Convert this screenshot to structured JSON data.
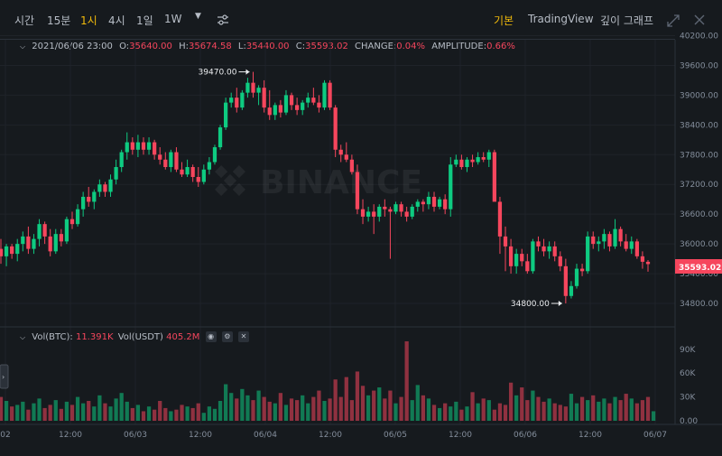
{
  "toolbar": {
    "items": [
      "시간",
      "15분",
      "1시",
      "4시",
      "1일",
      "1W"
    ],
    "active": "1시",
    "views": [
      "기본",
      "TradingView",
      "깊이 그래프"
    ],
    "active_view": "기본"
  },
  "ohlc": {
    "date": "2021/06/06 23:00",
    "o_label": "O:",
    "o": "35640.00",
    "h_label": "H:",
    "h": "35674.58",
    "l_label": "L:",
    "l": "35440.00",
    "c_label": "C:",
    "c": "35593.02",
    "change_label": "CHANGE:",
    "change": "0.04%",
    "amp_label": "AMPLITUDE:",
    "amp": "0.66%"
  },
  "volume_legend": {
    "btc_label": "Vol(BTC):",
    "btc": "11.391K",
    "usdt_label": "Vol(USDT)",
    "usdt": "405.2M"
  },
  "watermark": "BINANCE",
  "colors": {
    "up": "#0ecb81",
    "down": "#f6465d",
    "bg": "#161a1e",
    "accent": "#f0b90b"
  },
  "chart_data": {
    "type": "candlestick",
    "price_ticks": [
      "40200.00",
      "39600.00",
      "39000.00",
      "38400.00",
      "37800.00",
      "37200.00",
      "36600.00",
      "36000.00",
      "35400.00",
      "34800.00"
    ],
    "price_ylim": [
      34600,
      40300
    ],
    "volume_ticks": [
      "90K",
      "60K",
      "30K",
      "0.00"
    ],
    "volume_ylim": [
      0,
      100
    ],
    "time_ticks": [
      "02",
      "12:00",
      "06/03",
      "12:00",
      "06/04",
      "12:00",
      "06/05",
      "12:00",
      "06/06",
      "12:00",
      "06/07"
    ],
    "last_price": "35593.02",
    "annotations": [
      {
        "label": "39470.00",
        "value": 39470
      },
      {
        "label": "34800.00",
        "value": 34800
      }
    ],
    "candles": [
      {
        "o": 35900,
        "h": 36100,
        "l": 35600,
        "c": 35750
      },
      {
        "o": 35750,
        "h": 36000,
        "l": 35550,
        "c": 35950
      },
      {
        "o": 35950,
        "h": 36000,
        "l": 35700,
        "c": 35800
      },
      {
        "o": 35800,
        "h": 36100,
        "l": 35650,
        "c": 36000
      },
      {
        "o": 36000,
        "h": 36250,
        "l": 35850,
        "c": 36150
      },
      {
        "o": 36150,
        "h": 36350,
        "l": 35800,
        "c": 35900
      },
      {
        "o": 35900,
        "h": 36200,
        "l": 35800,
        "c": 36100
      },
      {
        "o": 36100,
        "h": 36500,
        "l": 35950,
        "c": 36400
      },
      {
        "o": 36400,
        "h": 36450,
        "l": 36000,
        "c": 36150
      },
      {
        "o": 36150,
        "h": 36300,
        "l": 35750,
        "c": 35850
      },
      {
        "o": 35850,
        "h": 36300,
        "l": 35800,
        "c": 36200
      },
      {
        "o": 36200,
        "h": 36300,
        "l": 35950,
        "c": 36050
      },
      {
        "o": 36050,
        "h": 36550,
        "l": 36000,
        "c": 36500
      },
      {
        "o": 36500,
        "h": 36650,
        "l": 36300,
        "c": 36400
      },
      {
        "o": 36400,
        "h": 36800,
        "l": 36350,
        "c": 36700
      },
      {
        "o": 36700,
        "h": 37050,
        "l": 36550,
        "c": 36950
      },
      {
        "o": 36950,
        "h": 37150,
        "l": 36750,
        "c": 36850
      },
      {
        "o": 36850,
        "h": 37100,
        "l": 36700,
        "c": 37050
      },
      {
        "o": 37050,
        "h": 37300,
        "l": 36950,
        "c": 37200
      },
      {
        "o": 37200,
        "h": 37250,
        "l": 36950,
        "c": 37050
      },
      {
        "o": 37050,
        "h": 37400,
        "l": 36950,
        "c": 37300
      },
      {
        "o": 37300,
        "h": 37700,
        "l": 37200,
        "c": 37550
      },
      {
        "o": 37550,
        "h": 37900,
        "l": 37450,
        "c": 37850
      },
      {
        "o": 37850,
        "h": 38250,
        "l": 37700,
        "c": 38050
      },
      {
        "o": 38050,
        "h": 38150,
        "l": 37800,
        "c": 37900
      },
      {
        "o": 37900,
        "h": 38200,
        "l": 37750,
        "c": 38050
      },
      {
        "o": 38050,
        "h": 38150,
        "l": 37800,
        "c": 37900
      },
      {
        "o": 37900,
        "h": 38150,
        "l": 37800,
        "c": 38050
      },
      {
        "o": 38050,
        "h": 38100,
        "l": 37700,
        "c": 37800
      },
      {
        "o": 37800,
        "h": 37950,
        "l": 37600,
        "c": 37700
      },
      {
        "o": 37700,
        "h": 37850,
        "l": 37500,
        "c": 37550
      },
      {
        "o": 37550,
        "h": 37900,
        "l": 37450,
        "c": 37850
      },
      {
        "o": 37850,
        "h": 37950,
        "l": 37450,
        "c": 37500
      },
      {
        "o": 37500,
        "h": 37650,
        "l": 37350,
        "c": 37400
      },
      {
        "o": 37400,
        "h": 37700,
        "l": 37350,
        "c": 37550
      },
      {
        "o": 37550,
        "h": 37600,
        "l": 37250,
        "c": 37350
      },
      {
        "o": 37350,
        "h": 37550,
        "l": 37150,
        "c": 37250
      },
      {
        "o": 37250,
        "h": 37600,
        "l": 37200,
        "c": 37500
      },
      {
        "o": 37500,
        "h": 37750,
        "l": 37400,
        "c": 37650
      },
      {
        "o": 37650,
        "h": 38000,
        "l": 37600,
        "c": 37950
      },
      {
        "o": 37950,
        "h": 38400,
        "l": 37900,
        "c": 38350
      },
      {
        "o": 38350,
        "h": 38950,
        "l": 38300,
        "c": 38850
      },
      {
        "o": 38850,
        "h": 39050,
        "l": 38750,
        "c": 38950
      },
      {
        "o": 38950,
        "h": 39150,
        "l": 38650,
        "c": 38750
      },
      {
        "o": 38750,
        "h": 39100,
        "l": 38700,
        "c": 39050
      },
      {
        "o": 39050,
        "h": 39350,
        "l": 38950,
        "c": 39250
      },
      {
        "o": 39250,
        "h": 39470,
        "l": 38950,
        "c": 39050
      },
      {
        "o": 39050,
        "h": 39200,
        "l": 38800,
        "c": 39150
      },
      {
        "o": 39150,
        "h": 39300,
        "l": 38650,
        "c": 38750
      },
      {
        "o": 38750,
        "h": 39100,
        "l": 38500,
        "c": 38600
      },
      {
        "o": 38600,
        "h": 38850,
        "l": 38500,
        "c": 38800
      },
      {
        "o": 38800,
        "h": 38900,
        "l": 38550,
        "c": 38650
      },
      {
        "o": 38650,
        "h": 39100,
        "l": 38600,
        "c": 39000
      },
      {
        "o": 39000,
        "h": 39050,
        "l": 38700,
        "c": 38800
      },
      {
        "o": 38800,
        "h": 38950,
        "l": 38600,
        "c": 38700
      },
      {
        "o": 38700,
        "h": 38900,
        "l": 38600,
        "c": 38850
      },
      {
        "o": 38850,
        "h": 39050,
        "l": 38750,
        "c": 38950
      },
      {
        "o": 38950,
        "h": 39150,
        "l": 38800,
        "c": 38850
      },
      {
        "o": 38850,
        "h": 39000,
        "l": 38650,
        "c": 38750
      },
      {
        "o": 38750,
        "h": 39300,
        "l": 38700,
        "c": 39250
      },
      {
        "o": 39250,
        "h": 39300,
        "l": 38700,
        "c": 38750
      },
      {
        "o": 38750,
        "h": 38800,
        "l": 37750,
        "c": 37900
      },
      {
        "o": 37900,
        "h": 38000,
        "l": 37650,
        "c": 37800
      },
      {
        "o": 37800,
        "h": 38050,
        "l": 37650,
        "c": 37700
      },
      {
        "o": 37700,
        "h": 37800,
        "l": 37400,
        "c": 37450
      },
      {
        "o": 37450,
        "h": 37600,
        "l": 36600,
        "c": 36700
      },
      {
        "o": 36700,
        "h": 36900,
        "l": 36400,
        "c": 36550
      },
      {
        "o": 36550,
        "h": 36750,
        "l": 36450,
        "c": 36650
      },
      {
        "o": 36650,
        "h": 36800,
        "l": 36200,
        "c": 36550
      },
      {
        "o": 36550,
        "h": 36800,
        "l": 36450,
        "c": 36750
      },
      {
        "o": 36750,
        "h": 36900,
        "l": 36550,
        "c": 36700
      },
      {
        "o": 36700,
        "h": 36750,
        "l": 35700,
        "c": 36650
      },
      {
        "o": 36650,
        "h": 36850,
        "l": 36600,
        "c": 36800
      },
      {
        "o": 36800,
        "h": 36850,
        "l": 36550,
        "c": 36650
      },
      {
        "o": 36650,
        "h": 36750,
        "l": 36450,
        "c": 36550
      },
      {
        "o": 36550,
        "h": 36800,
        "l": 36500,
        "c": 36750
      },
      {
        "o": 36750,
        "h": 36900,
        "l": 36650,
        "c": 36850
      },
      {
        "o": 36850,
        "h": 36900,
        "l": 36650,
        "c": 36800
      },
      {
        "o": 36800,
        "h": 37050,
        "l": 36700,
        "c": 36950
      },
      {
        "o": 36950,
        "h": 37050,
        "l": 36650,
        "c": 36750
      },
      {
        "o": 36750,
        "h": 36950,
        "l": 36700,
        "c": 36900
      },
      {
        "o": 36900,
        "h": 37000,
        "l": 36600,
        "c": 36700
      },
      {
        "o": 36700,
        "h": 37750,
        "l": 36550,
        "c": 37600
      },
      {
        "o": 37600,
        "h": 37800,
        "l": 37550,
        "c": 37700
      },
      {
        "o": 37700,
        "h": 37800,
        "l": 37500,
        "c": 37550
      },
      {
        "o": 37550,
        "h": 37750,
        "l": 37450,
        "c": 37700
      },
      {
        "o": 37700,
        "h": 37800,
        "l": 37550,
        "c": 37650
      },
      {
        "o": 37650,
        "h": 37850,
        "l": 37600,
        "c": 37750
      },
      {
        "o": 37750,
        "h": 37850,
        "l": 37650,
        "c": 37700
      },
      {
        "o": 37700,
        "h": 37900,
        "l": 37550,
        "c": 37850
      },
      {
        "o": 37850,
        "h": 37900,
        "l": 37050,
        "c": 36850
      },
      {
        "o": 36850,
        "h": 36950,
        "l": 35800,
        "c": 36150
      },
      {
        "o": 36150,
        "h": 36350,
        "l": 35450,
        "c": 35950
      },
      {
        "o": 35950,
        "h": 36100,
        "l": 35400,
        "c": 35550
      },
      {
        "o": 35550,
        "h": 35900,
        "l": 35400,
        "c": 35800
      },
      {
        "o": 35800,
        "h": 35900,
        "l": 35550,
        "c": 35650
      },
      {
        "o": 35650,
        "h": 35800,
        "l": 35400,
        "c": 35450
      },
      {
        "o": 35450,
        "h": 36100,
        "l": 35400,
        "c": 36050
      },
      {
        "o": 36050,
        "h": 36150,
        "l": 35850,
        "c": 35950
      },
      {
        "o": 35950,
        "h": 36100,
        "l": 35750,
        "c": 35850
      },
      {
        "o": 35850,
        "h": 36050,
        "l": 35700,
        "c": 35950
      },
      {
        "o": 35950,
        "h": 36050,
        "l": 35650,
        "c": 35750
      },
      {
        "o": 35750,
        "h": 35850,
        "l": 35450,
        "c": 35550
      },
      {
        "o": 35550,
        "h": 35700,
        "l": 34800,
        "c": 34950
      },
      {
        "o": 34950,
        "h": 35250,
        "l": 34900,
        "c": 35150
      },
      {
        "o": 35150,
        "h": 35600,
        "l": 35100,
        "c": 35500
      },
      {
        "o": 35500,
        "h": 35600,
        "l": 35350,
        "c": 35450
      },
      {
        "o": 35450,
        "h": 36250,
        "l": 35400,
        "c": 36150
      },
      {
        "o": 36150,
        "h": 36250,
        "l": 35900,
        "c": 36000
      },
      {
        "o": 36000,
        "h": 36150,
        "l": 35850,
        "c": 36050
      },
      {
        "o": 36050,
        "h": 36300,
        "l": 35900,
        "c": 36200
      },
      {
        "o": 36200,
        "h": 36250,
        "l": 35850,
        "c": 35950
      },
      {
        "o": 35950,
        "h": 36500,
        "l": 35900,
        "c": 36300
      },
      {
        "o": 36300,
        "h": 36350,
        "l": 35950,
        "c": 36050
      },
      {
        "o": 36050,
        "h": 36200,
        "l": 35850,
        "c": 35900
      },
      {
        "o": 35900,
        "h": 36150,
        "l": 35800,
        "c": 36050
      },
      {
        "o": 36050,
        "h": 36100,
        "l": 35700,
        "c": 35750
      },
      {
        "o": 35750,
        "h": 35850,
        "l": 35500,
        "c": 35640
      },
      {
        "o": 35640,
        "h": 35674.58,
        "l": 35440,
        "c": 35593.02
      }
    ],
    "volume": [
      30,
      25,
      18,
      20,
      24,
      14,
      22,
      28,
      16,
      20,
      26,
      15,
      24,
      20,
      30,
      22,
      25,
      18,
      32,
      22,
      18,
      28,
      35,
      24,
      16,
      20,
      12,
      18,
      14,
      25,
      16,
      12,
      14,
      20,
      18,
      16,
      22,
      10,
      18,
      15,
      25,
      46,
      35,
      28,
      40,
      32,
      26,
      38,
      30,
      24,
      22,
      35,
      20,
      28,
      26,
      32,
      22,
      30,
      38,
      25,
      28,
      52,
      30,
      55,
      26,
      62,
      44,
      32,
      38,
      42,
      28,
      38,
      22,
      30,
      100,
      26,
      45,
      32,
      28,
      20,
      16,
      22,
      18,
      24,
      14,
      18,
      36,
      22,
      28,
      26,
      14,
      22,
      20,
      48,
      32,
      42,
      26,
      38,
      30,
      24,
      28,
      22,
      20,
      18,
      34,
      22,
      30,
      26,
      32,
      24,
      28,
      22,
      30,
      26,
      34,
      28,
      22,
      26,
      30,
      12
    ]
  }
}
